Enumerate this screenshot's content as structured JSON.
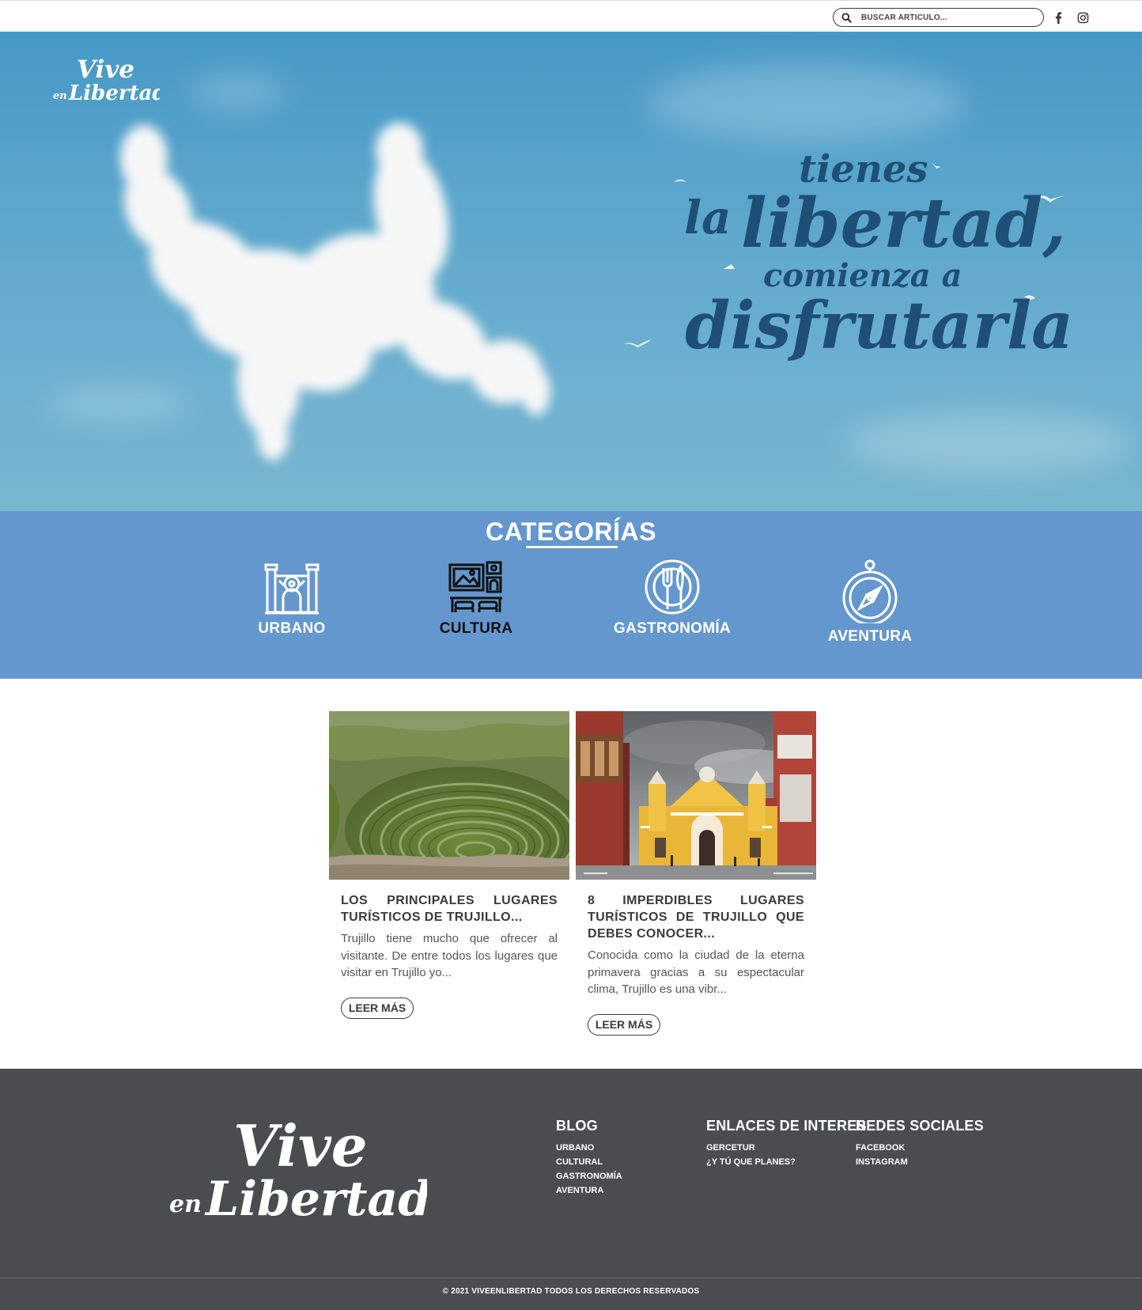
{
  "brand": {
    "logo_line1": "Vive",
    "logo_line2a": "en",
    "logo_line2b": "Libertad"
  },
  "topbar": {
    "search_placeholder": "BUSCAR ARTÍCULO...",
    "search_icon": "magnifier-icon",
    "social": [
      "facebook-icon",
      "instagram-icon"
    ]
  },
  "hero": {
    "line1": "tienes",
    "line2a": "la",
    "line2b": "libertad,",
    "line3": "comienza a",
    "line4": "disfrutarla",
    "text_color": "#1f4f75"
  },
  "categories": {
    "title": "CATEGORÍAS",
    "items": [
      {
        "label": "URBANO",
        "icon": "building-icon",
        "color": "#ffffff"
      },
      {
        "label": "CULTURA",
        "icon": "museum-gallery-icon",
        "color": "#111111"
      },
      {
        "label": "GASTRONOMÍA",
        "icon": "plate-cutlery-icon",
        "color": "#ffffff"
      },
      {
        "label": "AVENTURA",
        "icon": "compass-icon",
        "color": "#ffffff"
      }
    ]
  },
  "posts": [
    {
      "title": "LOS PRINCIPALES LUGARES TURÍSTICOS DE TRUJILLO...",
      "excerpt": "Trujillo tiene mucho que ofrecer al visitante. De entre todos los lugares que visitar en Trujillo yo...",
      "button": "LEER MÁS"
    },
    {
      "title": "8 IMPERDIBLES LUGARES TURÍSTICOS DE TRUJILLO QUE DEBES CONOCER...",
      "excerpt": "Conocida como la ciudad de la eterna primavera gracias a su espectacular clima, Trujillo es una vibr...",
      "button": "LEER MÁS"
    }
  ],
  "footer": {
    "columns": [
      {
        "title": "BLOG",
        "links": [
          "URBANO",
          "CULTURAL",
          "GASTRONOMÍA",
          "AVENTURA"
        ]
      },
      {
        "title": "ENLACES DE INTERES",
        "links": [
          "GERCETUR",
          "¿Y TÚ QUE PLANES?"
        ]
      },
      {
        "title": "REDES SOCIALES",
        "links": [
          "FACEBOOK",
          "INSTAGRAM"
        ]
      }
    ],
    "copyright": "© 2021 VIVEENLIBERTAD TODOS LOS DERECHOS RESERVADOS"
  },
  "colors": {
    "category_band": "#6497cd",
    "footer": "#4a4d50",
    "hero_sky": "#5ba6cc"
  }
}
